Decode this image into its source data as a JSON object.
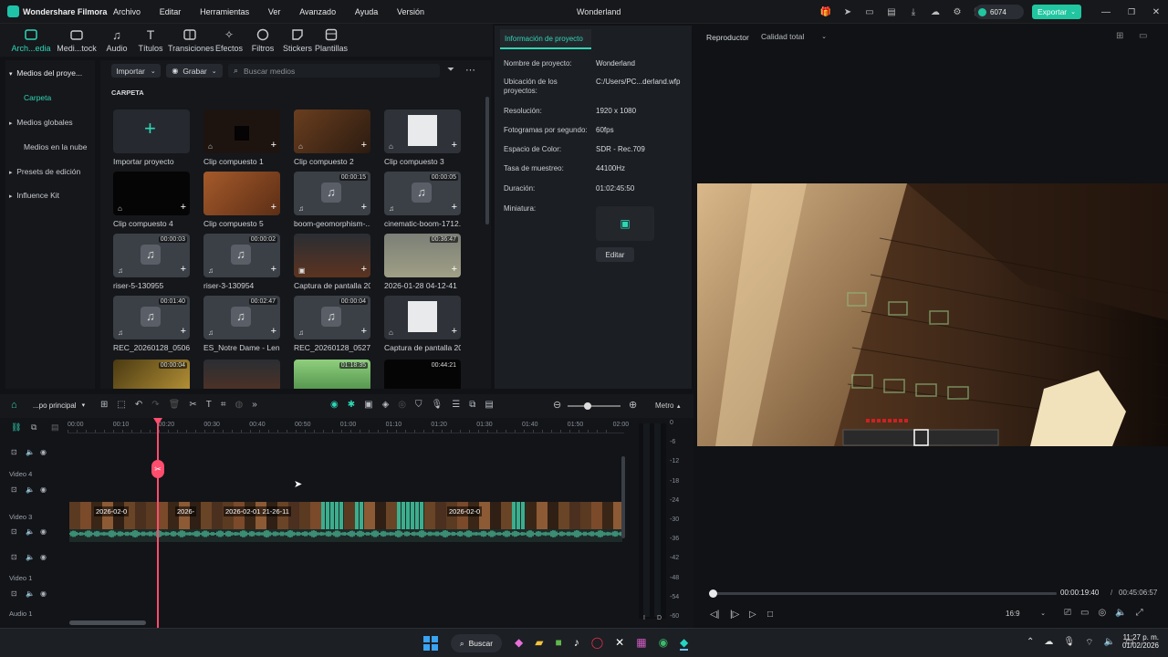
{
  "app": {
    "name": "Wondershare Filmora",
    "project_title": "Wonderland",
    "credits": "6074",
    "export_label": "Exportar",
    "menu": [
      "Archivo",
      "Editar",
      "Herramientas",
      "Ver",
      "Avanzado",
      "Ayuda",
      "Versión"
    ]
  },
  "toolbar": [
    "Arch...edia",
    "Medi...tock",
    "Audio",
    "Títulos",
    "Transiciones",
    "Efectos",
    "Filtros",
    "Stickers",
    "Plantillas"
  ],
  "sidebar": {
    "items": [
      "Medios del proye...",
      "Carpeta",
      "Medios globales",
      "Medios en la nube",
      "Presets de edición",
      "Influence Kit"
    ]
  },
  "media": {
    "import_label": "Importar",
    "record_label": "Grabar",
    "search_placeholder": "Buscar medios",
    "folder_label": "CARPETA",
    "tiles": [
      {
        "name": "Importar proyecto",
        "dur": ""
      },
      {
        "name": "Clip compuesto 1",
        "dur": ""
      },
      {
        "name": "Clip compuesto 2",
        "dur": ""
      },
      {
        "name": "Clip compuesto 3",
        "dur": ""
      },
      {
        "name": "Clip compuesto 4",
        "dur": ""
      },
      {
        "name": "Clip compuesto 5",
        "dur": ""
      },
      {
        "name": "boom-geomorphism-...",
        "dur": "00:00:15"
      },
      {
        "name": "cinematic-boom-1712...",
        "dur": "00:00:05"
      },
      {
        "name": "riser-5-130955",
        "dur": "00:00:03"
      },
      {
        "name": "riser-3-130954",
        "dur": "00:00:02"
      },
      {
        "name": "Captura de pantalla 20...",
        "dur": ""
      },
      {
        "name": "2026-01-28 04-12-41",
        "dur": "00:36:47"
      },
      {
        "name": "REC_20260128_050657",
        "dur": "00:01:40"
      },
      {
        "name": "ES_Notre Dame - Lenn...",
        "dur": "00:02:47"
      },
      {
        "name": "REC_20260128_052727",
        "dur": "00:00:04"
      },
      {
        "name": "Captura de pantalla 20...",
        "dur": ""
      },
      {
        "name": "",
        "dur": "00:00:04"
      },
      {
        "name": "",
        "dur": ""
      },
      {
        "name": "",
        "dur": "01:18:35"
      },
      {
        "name": "",
        "dur": "00:44:21"
      }
    ]
  },
  "info": {
    "tab": "Información de proyecto",
    "rows": [
      {
        "label": "Nombre de proyecto:",
        "value": "Wonderland"
      },
      {
        "label": "Ubicación de los proyectos:",
        "value": "C:/Users/PC...derland.wfp"
      },
      {
        "label": "Resolución:",
        "value": "1920 x 1080"
      },
      {
        "label": "Fotogramas por segundo:",
        "value": "60fps"
      },
      {
        "label": "Espacio de Color:",
        "value": "SDR - Rec.709"
      },
      {
        "label": "Tasa de muestreo:",
        "value": "44100Hz"
      },
      {
        "label": "Duración:",
        "value": "01:02:45:50"
      },
      {
        "label": "Miniatura:",
        "value": ""
      }
    ],
    "edit_label": "Editar"
  },
  "player": {
    "label": "Reproductor",
    "quality": "Calidad total",
    "current": "00:00:19:40",
    "separator": "/",
    "total": "00:45:06:57",
    "ratio": "16:9",
    "progress": 0.007
  },
  "timeline": {
    "sequence": "...po principal",
    "meter_label": "Metro",
    "ruler": [
      "00:00",
      "00:10",
      "00:20",
      "00:30",
      "00:40",
      "00:50",
      "01:00",
      "01:10",
      "01:20",
      "01:30",
      "01:40",
      "01:50",
      "02:00"
    ],
    "tracks": [
      "Video 4",
      "Video 3",
      "Video 1",
      "Audio 1"
    ],
    "clip_labels": [
      "2026-02-0",
      "2026-",
      "2026-02-01 21-26-11",
      "2026-02-0"
    ],
    "meter_scale": [
      "0",
      "-6",
      "-12",
      "-18",
      "-24",
      "-30",
      "-36",
      "-42",
      "-48",
      "-54",
      "-60"
    ],
    "meter_lr": [
      "I",
      "D"
    ]
  },
  "taskbar": {
    "search": "Buscar",
    "time": "11:27 p. m.",
    "date": "01/02/2026"
  },
  "colors": {
    "accent": "#2fd6b6",
    "playhead": "#ff4d6d",
    "export": "#21c6a0"
  }
}
